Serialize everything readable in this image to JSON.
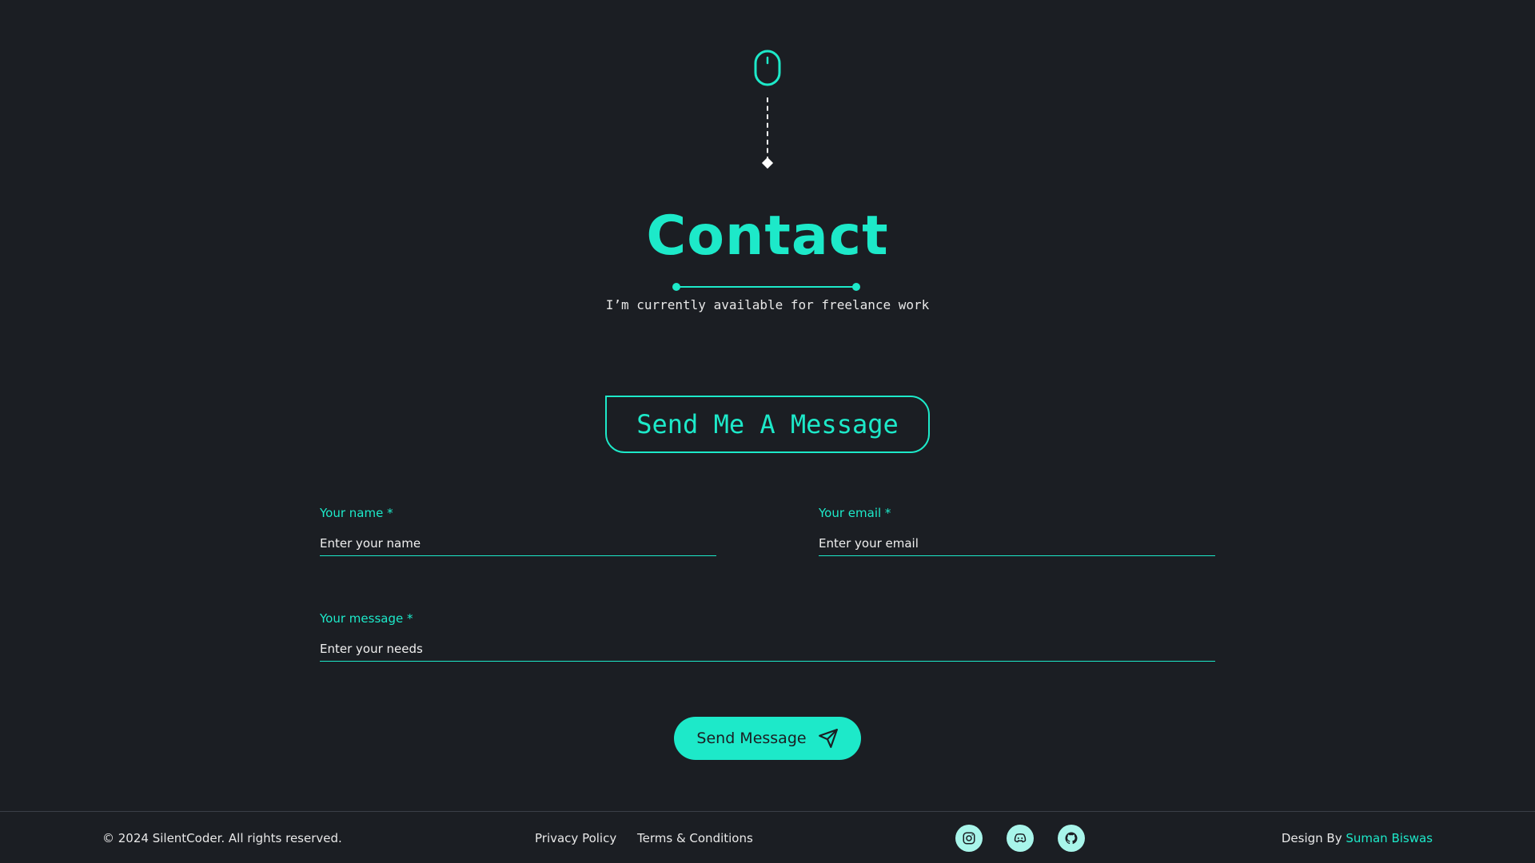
{
  "colors": {
    "accent": "#1de9c9",
    "background": "#1b1e23"
  },
  "hero": {
    "title": "Contact",
    "subtitle": "I’m currently available for freelance work"
  },
  "message_box": {
    "label": "Send Me A Message"
  },
  "form": {
    "name": {
      "label": "Your name *",
      "placeholder": "Enter your name"
    },
    "email": {
      "label": "Your email *",
      "placeholder": "Enter your email"
    },
    "message": {
      "label": "Your message *",
      "placeholder": "Enter your needs"
    },
    "submit_label": "Send Message"
  },
  "footer": {
    "copyright": "© 2024 SilentCoder. All rights reserved.",
    "links": {
      "privacy": "Privacy Policy",
      "terms": "Terms & Conditions"
    },
    "social_icons": [
      "instagram-icon",
      "discord-icon",
      "github-icon"
    ],
    "design_by_prefix": "Design By ",
    "design_by_name": "Suman Biswas"
  }
}
